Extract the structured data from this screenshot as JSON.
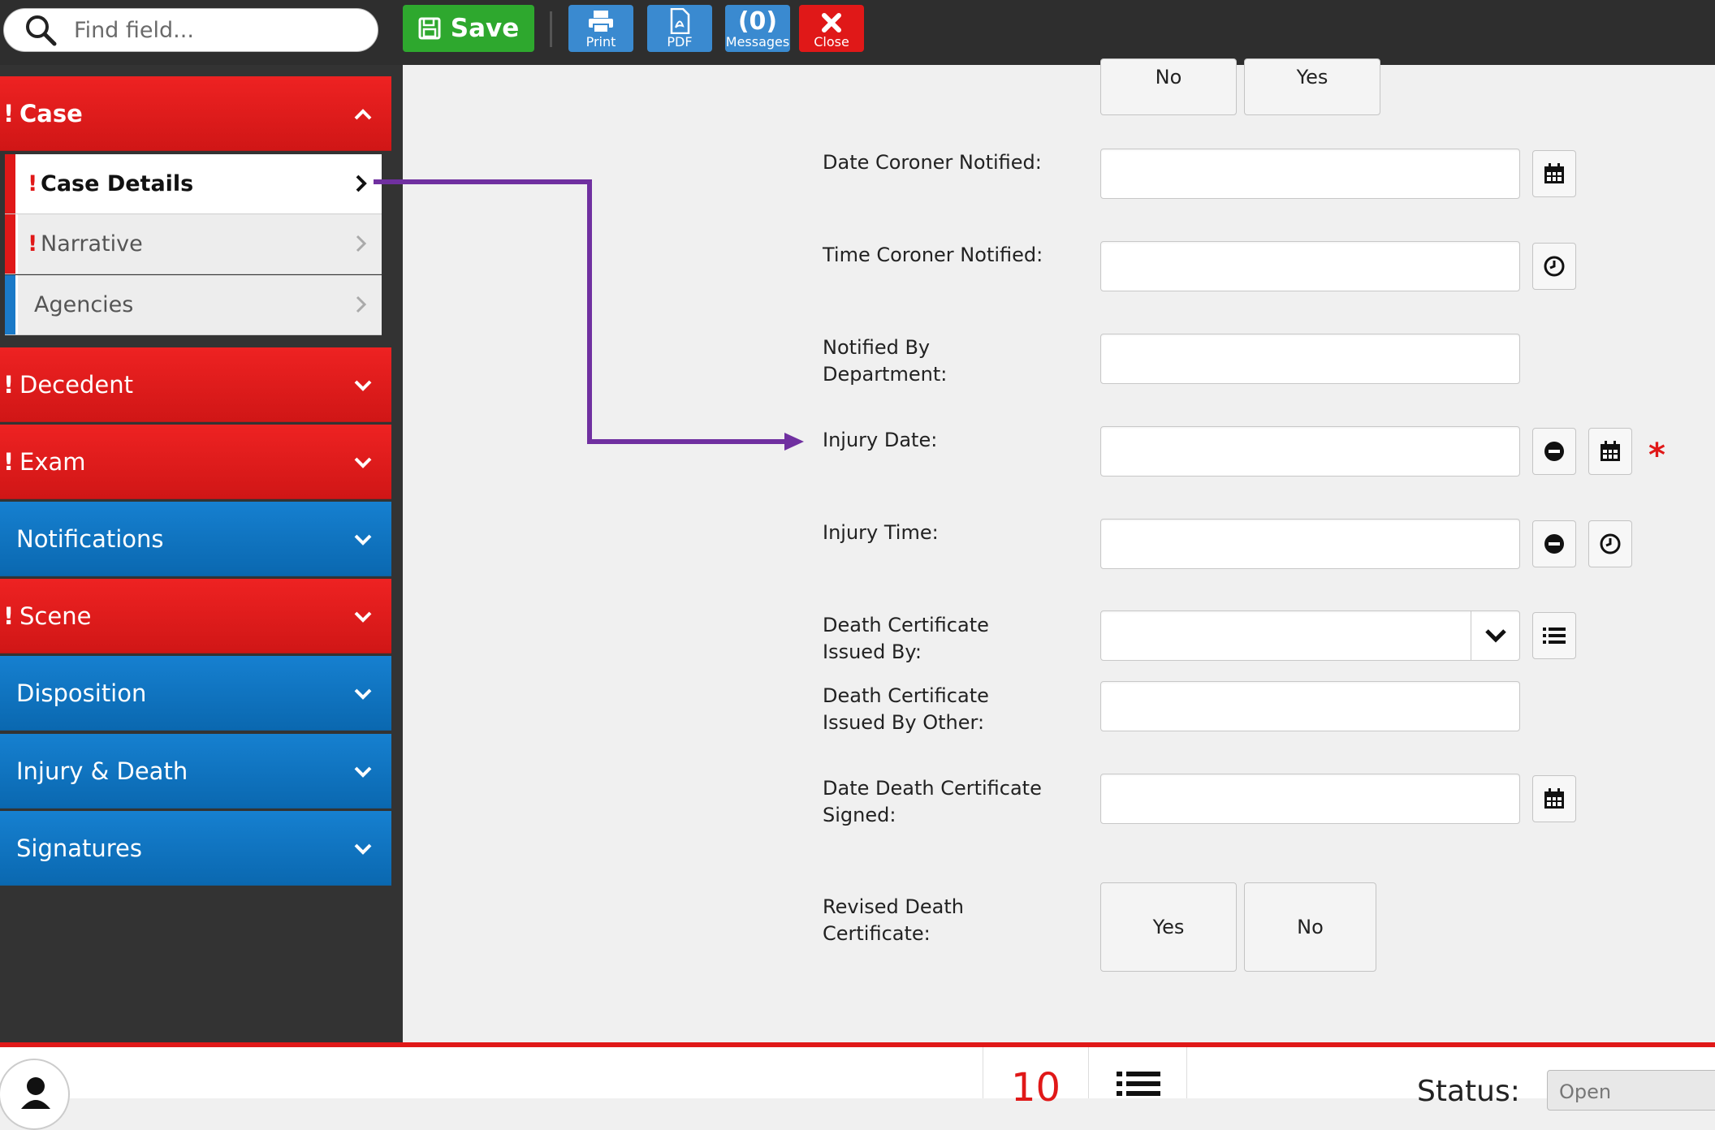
{
  "search": {
    "placeholder": "Find field..."
  },
  "toolbar": {
    "save_label": "Save",
    "print_label": "Print",
    "pdf_label": "PDF",
    "messages_count": "(0)",
    "messages_label": "Messages",
    "close_label": "Close"
  },
  "sidebar": {
    "sections": [
      {
        "label": "Case",
        "alert": "!",
        "color": "red"
      },
      {
        "label": "Decedent",
        "alert": "!",
        "color": "red"
      },
      {
        "label": "Exam",
        "alert": "!",
        "color": "red"
      },
      {
        "label": "Notifications",
        "alert": "",
        "color": "blue"
      },
      {
        "label": "Scene",
        "alert": "!",
        "color": "red"
      },
      {
        "label": "Disposition",
        "alert": "",
        "color": "blue"
      },
      {
        "label": "Injury & Death",
        "alert": "",
        "color": "blue"
      },
      {
        "label": "Signatures",
        "alert": "",
        "color": "blue"
      }
    ],
    "case_items": [
      {
        "label": "Case Details",
        "alert": "!"
      },
      {
        "label": "Narrative",
        "alert": "!"
      },
      {
        "label": "Agencies",
        "alert": ""
      }
    ]
  },
  "form": {
    "top_buttons": {
      "no": "No",
      "yes": "Yes"
    },
    "fields": [
      {
        "label_line1": "Date Coroner Notified:",
        "label_line2": ""
      },
      {
        "label_line1": "Time Coroner Notified:",
        "label_line2": ""
      },
      {
        "label_line1": "Notified By",
        "label_line2": "Department:"
      },
      {
        "label_line1": "Injury Date:",
        "label_line2": ""
      },
      {
        "label_line1": "Injury Time:",
        "label_line2": ""
      },
      {
        "label_line1": "Death Certificate",
        "label_line2": "Issued By:"
      },
      {
        "label_line1": "Death Certificate",
        "label_line2": "Issued By Other:"
      },
      {
        "label_line1": "Date Death Certificate",
        "label_line2": "Signed:"
      },
      {
        "label_line1": "Revised Death",
        "label_line2": "Certificate:"
      }
    ],
    "revised_buttons": {
      "yes": "Yes",
      "no": "No"
    },
    "required_marker": "*"
  },
  "footer": {
    "count": "10",
    "status_label": "Status:",
    "status_value": "Open"
  },
  "colors": {
    "alert_red": "#e01818",
    "nav_blue": "#0a68b0",
    "save_green": "#2ea82e",
    "annotation_purple": "#7030a0"
  }
}
